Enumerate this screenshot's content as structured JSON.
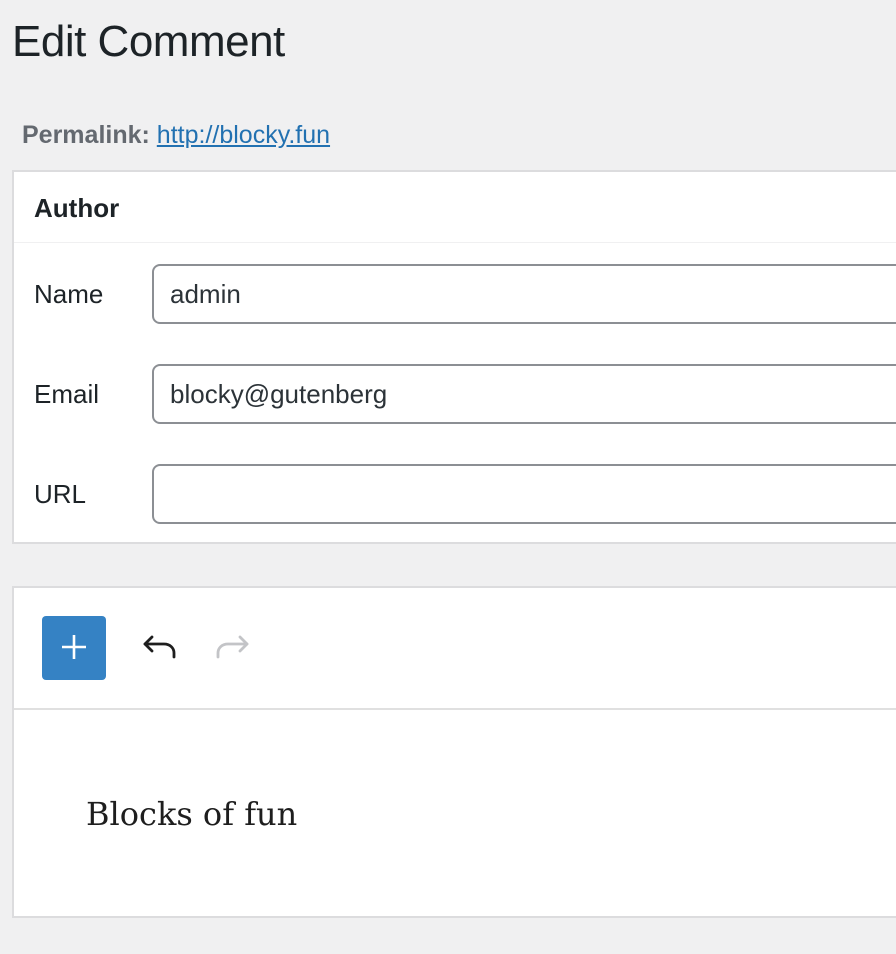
{
  "page": {
    "title": "Edit Comment"
  },
  "permalink": {
    "label": "Permalink:",
    "url_text": "http://blocky.fun"
  },
  "author": {
    "heading": "Author",
    "fields": {
      "name": {
        "label": "Name",
        "value": "admin"
      },
      "email": {
        "label": "Email",
        "value": "blocky@gutenberg"
      },
      "url": {
        "label": "URL",
        "value": ""
      }
    }
  },
  "editor": {
    "toolbar": {
      "add_block_icon": "plus-icon",
      "undo_icon": "undo-icon",
      "redo_icon": "redo-icon"
    },
    "content": {
      "paragraph": "Blocks of fun"
    }
  },
  "colors": {
    "accent": "#3582c4",
    "link": "#2271b1",
    "background": "#f0f0f1",
    "redo_disabled": "#c3c4c7"
  }
}
